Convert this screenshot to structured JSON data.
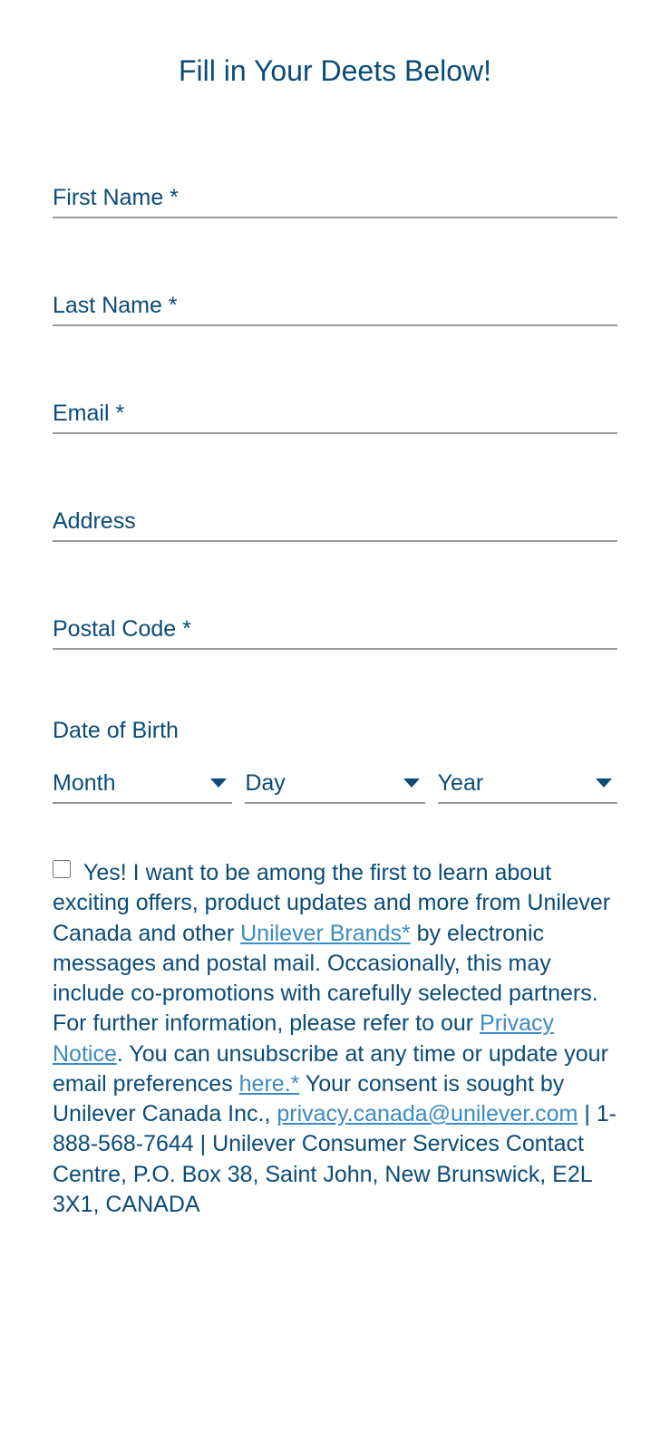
{
  "title": "Fill in Your Deets Below!",
  "fields": {
    "first_name": "First Name *",
    "last_name": "Last Name *",
    "email": "Email *",
    "address": "Address",
    "postal_code": "Postal Code *"
  },
  "dob": {
    "label": "Date of Birth",
    "month": "Month",
    "day": "Day",
    "year": "Year"
  },
  "consent": {
    "t1": "Yes! I want to be among the first to learn about exciting offers, product updates and more from Unilever Canada and other ",
    "link1": "Unilever Brands*",
    "t2": " by electronic messages and postal mail. Occasionally, this may include co-promotions with carefully selected partners. For further information, please refer to our ",
    "link2": "Privacy Notice",
    "t3": ". You can unsubscribe at any time or update your email preferences ",
    "link3": "here.*",
    "t4": " Your consent is sought by Unilever Canada Inc., ",
    "link4": "privacy.canada@unilever.com",
    "t5": " | 1-888-568-7644 | Unilever Consumer Services Contact Centre, P.O. Box 38, Saint John, New Brunswick, E2L 3X1, CANADA"
  }
}
